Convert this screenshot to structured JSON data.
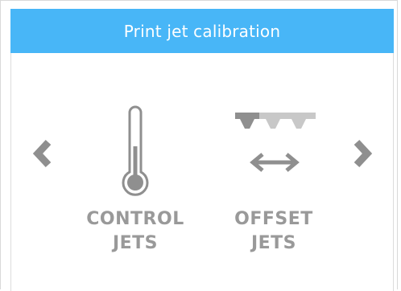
{
  "header": {
    "title": "Print jet calibration",
    "color": "#48b6f7"
  },
  "navigation": {
    "prev_icon": "chevron-left-icon",
    "next_icon": "chevron-right-icon"
  },
  "options": [
    {
      "line1": "CONTROL",
      "line2": "JETS",
      "icon": "thermometer-icon"
    },
    {
      "line1": "OFFSET",
      "line2": "JETS",
      "icon": "offset-jets-icon"
    }
  ],
  "colors": {
    "label": "#999999",
    "icon": "#8f8f8f",
    "icon_light": "#c8c8c8"
  }
}
